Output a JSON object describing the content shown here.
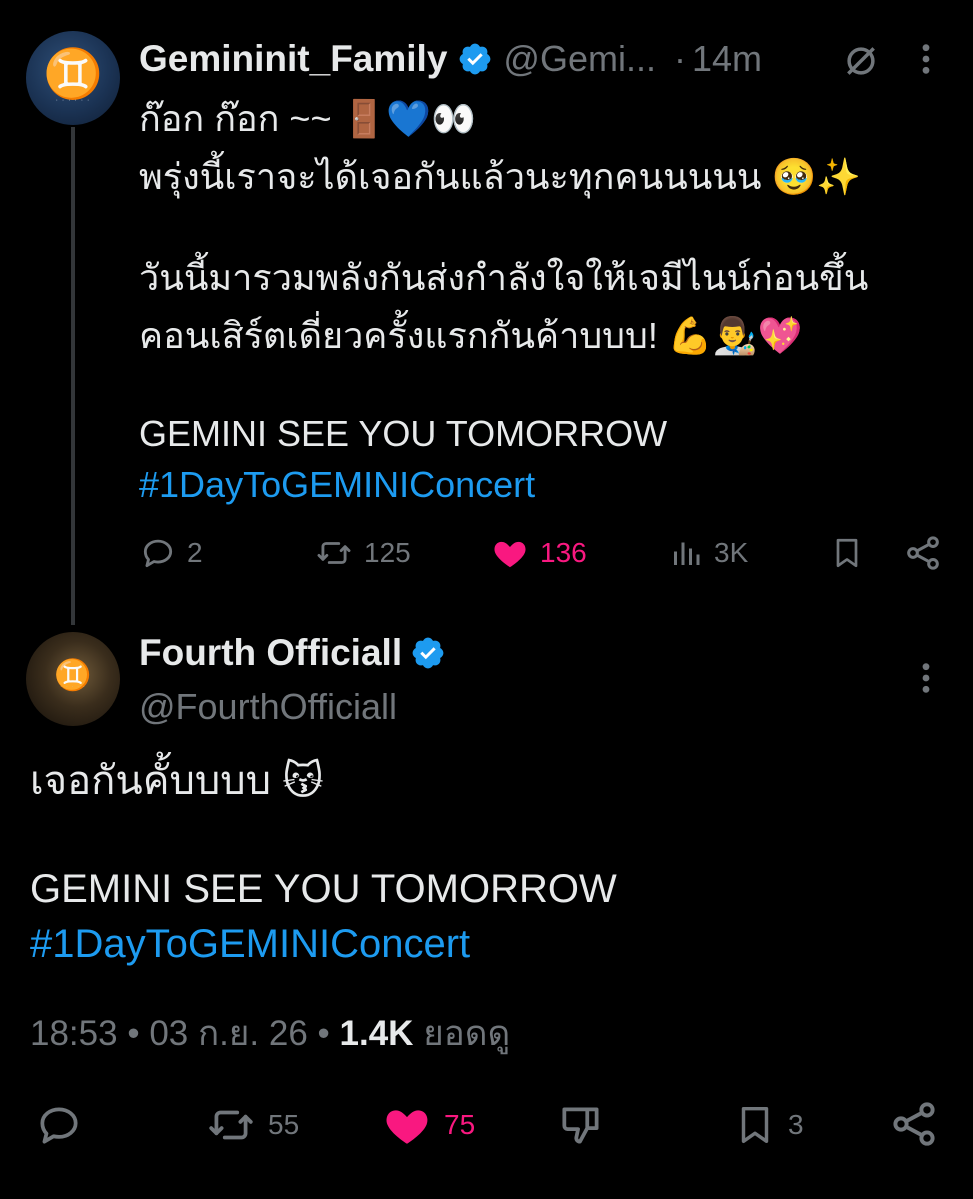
{
  "tweet1": {
    "name": "Gemininit_Family",
    "handle": "@Gemi...",
    "dot": "·",
    "time": "14m",
    "avatar_glyph": "♊",
    "lines": [
      "ก๊อก ก๊อก ~~ 🚪💙👀",
      "พรุ่งนี้เราจะได้เจอกันแล้วนะทุกคนนนนน 🥹✨",
      "วันนี้มารวมพลังกันส่งกำลังใจให้เจมีไนน์ก่อนขึ้น",
      "คอนเสิร์ตเดี่ยวครั้งแรกกันค้าบบบ! 💪👨‍🎨💖",
      "GEMINI SEE YOU TOMORROW"
    ],
    "hashtag": "#1DayToGEMINIConcert",
    "actions": {
      "replies": "2",
      "reposts": "125",
      "likes": "136",
      "views": "3K"
    }
  },
  "tweet2": {
    "name": "Fourth Officiall",
    "handle": "@FourthOfficiall",
    "avatar_glyph": "♊",
    "lines": [
      "เจอกันคั้บบบบ 😽",
      "GEMINI SEE YOU TOMORROW"
    ],
    "hashtag": "#1DayToGEMINIConcert",
    "meta": {
      "time": "18:53",
      "sep1": "•",
      "date": "03 ก.ย. 26",
      "sep2": "•",
      "views": "1.4K",
      "views_label": "ยอดดู"
    },
    "actions": {
      "reposts": "55",
      "likes": "75",
      "bookmarks": "3"
    }
  },
  "colors": {
    "background": "#000000",
    "text": "#e7e9ea",
    "secondary": "#71767b",
    "link": "#1d9bf0",
    "like": "#f91880",
    "verified": "#1d9bf0"
  }
}
